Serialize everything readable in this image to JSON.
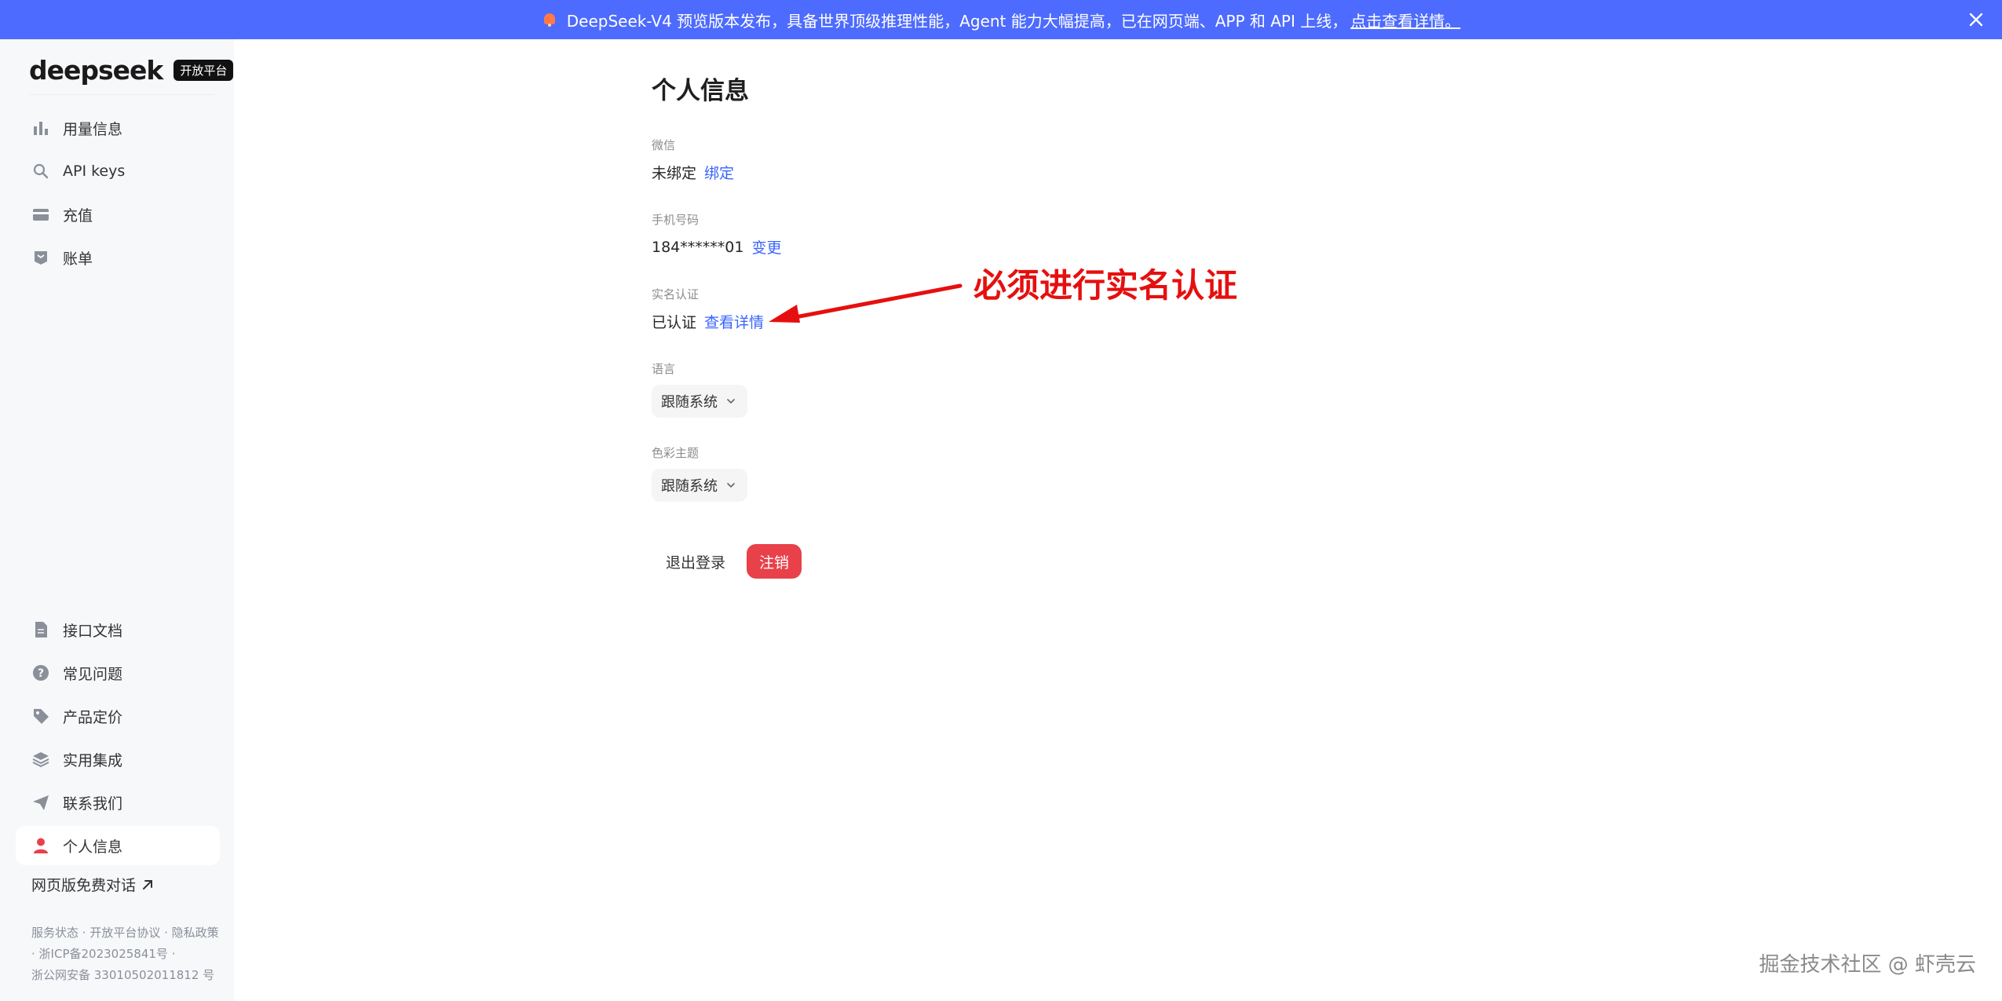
{
  "banner": {
    "text": "DeepSeek-V4 预览版本发布，具备世界顶级推理性能，Agent 能力大幅提高，已在网页端、APP 和 API 上线，",
    "link": "点击查看详情。"
  },
  "sidebar": {
    "logo": "deepseek",
    "badge": "开放平台",
    "top_items": [
      {
        "label": "用量信息",
        "icon": "bar-chart-icon"
      },
      {
        "label": "API keys",
        "icon": "search-icon"
      },
      {
        "label": "充值",
        "icon": "wallet-icon"
      },
      {
        "label": "账单",
        "icon": "bill-icon"
      }
    ],
    "bottom_items": [
      {
        "label": "接口文档",
        "icon": "document-icon"
      },
      {
        "label": "常见问题",
        "icon": "question-icon"
      },
      {
        "label": "产品定价",
        "icon": "tag-icon"
      },
      {
        "label": "实用集成",
        "icon": "layers-icon"
      },
      {
        "label": "联系我们",
        "icon": "send-icon"
      },
      {
        "label": "个人信息",
        "icon": "user-icon"
      }
    ],
    "web_chat": "网页版免费对话",
    "footer": {
      "status": "服务状态",
      "agreement": "开放平台协议",
      "privacy": "隐私政策",
      "icp": "浙ICP备2023025841号",
      "police": "浙公网安备 33010502011812 号"
    }
  },
  "main": {
    "title": "个人信息",
    "wechat": {
      "label": "微信",
      "value": "未绑定",
      "action": "绑定"
    },
    "phone": {
      "label": "手机号码",
      "value": "184******01",
      "action": "变更"
    },
    "realname": {
      "label": "实名认证",
      "value": "已认证",
      "action": "查看详情"
    },
    "language": {
      "label": "语言",
      "value": "跟随系统"
    },
    "theme": {
      "label": "色彩主题",
      "value": "跟随系统"
    },
    "logout": "退出登录",
    "cancel": "注销"
  },
  "annotation": {
    "text": "必须进行实名认证"
  },
  "watermark": "掘金技术社区 @ 虾壳云",
  "colors": {
    "banner": "#4d6bfe",
    "link": "#3964fe",
    "danger": "#e8414a",
    "annotation": "#e60f0f"
  }
}
